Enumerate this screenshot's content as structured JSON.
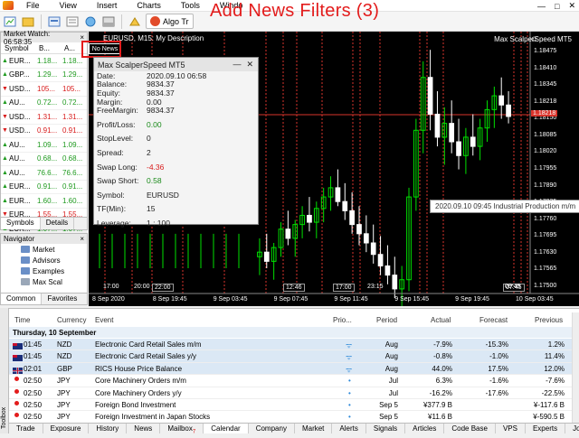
{
  "overlay_title": "Add News Filters (3)",
  "menu": [
    "File",
    "View",
    "Insert",
    "Charts",
    "Tools",
    "Windo"
  ],
  "window_controls": [
    "—",
    "□",
    "✕"
  ],
  "toolbar": {
    "algo_label": "Algo Tr"
  },
  "market_watch": {
    "title": "Market Watch: 06:58:35",
    "close": "×",
    "headers": [
      "Symbol",
      "B...",
      "A..."
    ],
    "rows": [
      {
        "dir": "up",
        "symbol": "EUR...",
        "bid": "1.18...",
        "ask": "1.18..."
      },
      {
        "dir": "up",
        "symbol": "GBP...",
        "bid": "1.29...",
        "ask": "1.29..."
      },
      {
        "dir": "down",
        "symbol": "USD...",
        "bid": "105...",
        "ask": "105..."
      },
      {
        "dir": "up",
        "symbol": "AU...",
        "bid": "0.72...",
        "ask": "0.72..."
      },
      {
        "dir": "down",
        "symbol": "USD...",
        "bid": "1.31...",
        "ask": "1.31..."
      },
      {
        "dir": "down",
        "symbol": "USD...",
        "bid": "0.91...",
        "ask": "0.91..."
      },
      {
        "dir": "up",
        "symbol": "AU...",
        "bid": "1.09...",
        "ask": "1.09..."
      },
      {
        "dir": "up",
        "symbol": "AU...",
        "bid": "0.68...",
        "ask": "0.68..."
      },
      {
        "dir": "up",
        "symbol": "AU...",
        "bid": "76.6...",
        "ask": "76.6..."
      },
      {
        "dir": "up",
        "symbol": "EUR...",
        "bid": "0.91...",
        "ask": "0.91..."
      },
      {
        "dir": "up",
        "symbol": "EUR...",
        "bid": "1.60...",
        "ask": "1.60..."
      },
      {
        "dir": "down",
        "symbol": "EUR...",
        "bid": "1.55...",
        "ask": "1.55..."
      },
      {
        "dir": "up",
        "symbol": "EUR...",
        "bid": "1.07...",
        "ask": "1.07..."
      }
    ],
    "tabs": [
      "Symbols",
      "Details"
    ]
  },
  "navigator": {
    "title": "Navigator",
    "items": [
      "Market",
      "Advisors",
      "Examples",
      "Max Scal"
    ],
    "tabs": [
      "Common",
      "Favorites"
    ]
  },
  "chart": {
    "symbol_title": "EURUSD, M15:  My Description",
    "ea_name": "Max ScalperSpeed MT5",
    "no_news": "No News",
    "tooltip": "2020.09.10 09:45 Industrial Production m/m",
    "price_labels": [
      "1.18475",
      "1.18410",
      "1.18345",
      "1.18218",
      "1.18150",
      "1.18085",
      "1.18020",
      "1.17955",
      "1.17890",
      "1.17825",
      "1.17760",
      "1.17695",
      "1.17630",
      "1.17565",
      "1.17500"
    ],
    "current_price": "1.18218",
    "time_labels": [
      "8 Sep 2020",
      "8 Sep 19:45",
      "9 Sep 03:45",
      "9 Sep 07:45",
      "9 Sep 11:45",
      "9 Sep 15:45",
      "9 Sep 19:45",
      "10 Sep 03:45"
    ],
    "event_times": [
      "17:00",
      "20:00",
      "22:00",
      "12:46",
      "17:00",
      "23:15",
      "05:05",
      "07:45",
      "09:45"
    ],
    "candles": [
      {
        "o": 1.176,
        "h": 1.1768,
        "l": 1.1752,
        "c": 1.1762
      },
      {
        "o": 1.1762,
        "h": 1.177,
        "l": 1.1755,
        "c": 1.1758
      },
      {
        "o": 1.1758,
        "h": 1.1766,
        "l": 1.175,
        "c": 1.1764
      },
      {
        "o": 1.1764,
        "h": 1.1775,
        "l": 1.176,
        "c": 1.1772
      },
      {
        "o": 1.1772,
        "h": 1.178,
        "l": 1.1765,
        "c": 1.1768
      },
      {
        "o": 1.1768,
        "h": 1.1776,
        "l": 1.176,
        "c": 1.1774
      },
      {
        "o": 1.1774,
        "h": 1.1782,
        "l": 1.1768,
        "c": 1.1778
      },
      {
        "o": 1.1778,
        "h": 1.1786,
        "l": 1.1771,
        "c": 1.1775
      },
      {
        "o": 1.1775,
        "h": 1.1784,
        "l": 1.1768,
        "c": 1.1781
      },
      {
        "o": 1.1781,
        "h": 1.179,
        "l": 1.1775,
        "c": 1.1786
      },
      {
        "o": 1.1786,
        "h": 1.1795,
        "l": 1.178,
        "c": 1.179
      },
      {
        "o": 1.179,
        "h": 1.1798,
        "l": 1.1782,
        "c": 1.1784
      },
      {
        "o": 1.1784,
        "h": 1.1792,
        "l": 1.1776,
        "c": 1.178
      },
      {
        "o": 1.178,
        "h": 1.1788,
        "l": 1.177,
        "c": 1.1774
      },
      {
        "o": 1.1774,
        "h": 1.1782,
        "l": 1.1765,
        "c": 1.177
      },
      {
        "o": 1.177,
        "h": 1.1778,
        "l": 1.1762,
        "c": 1.1766
      },
      {
        "o": 1.1766,
        "h": 1.1774,
        "l": 1.1757,
        "c": 1.1761
      },
      {
        "o": 1.1761,
        "h": 1.1769,
        "l": 1.1752,
        "c": 1.1756
      },
      {
        "o": 1.1756,
        "h": 1.1765,
        "l": 1.1748,
        "c": 1.1752
      },
      {
        "o": 1.1752,
        "h": 1.176,
        "l": 1.1742,
        "c": 1.1746
      },
      {
        "o": 1.1746,
        "h": 1.1756,
        "l": 1.1738,
        "c": 1.175
      },
      {
        "o": 1.175,
        "h": 1.179,
        "l": 1.1745,
        "c": 1.1786
      },
      {
        "o": 1.1786,
        "h": 1.182,
        "l": 1.178,
        "c": 1.1815
      },
      {
        "o": 1.1815,
        "h": 1.1845,
        "l": 1.1805,
        "c": 1.1838
      },
      {
        "o": 1.1838,
        "h": 1.185,
        "l": 1.1815,
        "c": 1.1822
      },
      {
        "o": 1.1822,
        "h": 1.1832,
        "l": 1.1808,
        "c": 1.1812
      },
      {
        "o": 1.1812,
        "h": 1.1825,
        "l": 1.18,
        "c": 1.1818
      },
      {
        "o": 1.1818,
        "h": 1.1828,
        "l": 1.1805,
        "c": 1.181
      },
      {
        "o": 1.181,
        "h": 1.182,
        "l": 1.1798,
        "c": 1.1804
      },
      {
        "o": 1.1804,
        "h": 1.1816,
        "l": 1.1796,
        "c": 1.1812
      },
      {
        "o": 1.1812,
        "h": 1.1822,
        "l": 1.1804,
        "c": 1.1808
      },
      {
        "o": 1.1808,
        "h": 1.182,
        "l": 1.1802,
        "c": 1.1816
      },
      {
        "o": 1.1816,
        "h": 1.1828,
        "l": 1.181,
        "c": 1.1824
      },
      {
        "o": 1.1824,
        "h": 1.1834,
        "l": 1.1816,
        "c": 1.183
      },
      {
        "o": 1.183,
        "h": 1.1838,
        "l": 1.182,
        "c": 1.1826
      },
      {
        "o": 1.1826,
        "h": 1.1832,
        "l": 1.1818,
        "c": 1.1821
      }
    ]
  },
  "panel": {
    "title": "Max ScalperSpeed MT5",
    "rows": [
      {
        "k": "Date:",
        "v": "2020.09.10 06:58",
        "c": ""
      },
      {
        "k": "Balance:",
        "v": "9834.37",
        "c": ""
      },
      {
        "k": "Equity:",
        "v": "9834.37",
        "c": ""
      },
      {
        "k": "Margin:",
        "v": "0.00",
        "c": ""
      },
      {
        "k": "FreeMargin:",
        "v": "9834.37",
        "c": ""
      },
      {
        "k": "",
        "v": "",
        "c": "gap"
      },
      {
        "k": "Profit/Loss:",
        "v": "0.00",
        "c": "pos"
      },
      {
        "k": "",
        "v": "",
        "c": "gap"
      },
      {
        "k": "StopLevel:",
        "v": "0",
        "c": ""
      },
      {
        "k": "",
        "v": "",
        "c": "gap"
      },
      {
        "k": "Spread:",
        "v": "2",
        "c": ""
      },
      {
        "k": "",
        "v": "",
        "c": "gap"
      },
      {
        "k": "Swap Long:",
        "v": "-4.36",
        "c": "neg"
      },
      {
        "k": "",
        "v": "",
        "c": "gap"
      },
      {
        "k": "Swap Short:",
        "v": "0.58",
        "c": "pos"
      },
      {
        "k": "",
        "v": "",
        "c": "gap"
      },
      {
        "k": "Symbol:",
        "v": "EURUSD",
        "c": ""
      },
      {
        "k": "",
        "v": "",
        "c": "gap"
      },
      {
        "k": "TF(Min):",
        "v": "15",
        "c": ""
      },
      {
        "k": "",
        "v": "",
        "c": "gap"
      },
      {
        "k": "Leverage:",
        "v": "1 : 100",
        "c": ""
      }
    ]
  },
  "calendar": {
    "headers": {
      "time": "Time",
      "currency": "Currency",
      "event": "Event",
      "prio": "Prio...",
      "period": "Period",
      "actual": "Actual",
      "forecast": "Forecast",
      "previous": "Previous"
    },
    "day": "Thursday, 10 September",
    "rows": [
      {
        "flag": "nz",
        "time": "01:45",
        "cur": "NZD",
        "event": "Electronic Card Retail Sales m/m",
        "imp": "high",
        "period": "Aug",
        "actual": "-7.9%",
        "forecast": "-15.3%",
        "previous": "1.2%",
        "alt": true
      },
      {
        "flag": "nz",
        "time": "01:45",
        "cur": "NZD",
        "event": "Electronic Card Retail Sales y/y",
        "imp": "high",
        "period": "Aug",
        "actual": "-0.8%",
        "forecast": "-1.0%",
        "previous": "11.4%",
        "alt": true
      },
      {
        "flag": "gb",
        "time": "02:01",
        "cur": "GBP",
        "event": "RICS House Price Balance",
        "imp": "high",
        "period": "Aug",
        "actual": "44.0%",
        "forecast": "17.5%",
        "previous": "12.0%",
        "alt": true
      },
      {
        "flag": "jp",
        "time": "02:50",
        "cur": "JPY",
        "event": "Core Machinery Orders m/m",
        "imp": "low",
        "period": "Jul",
        "actual": "6.3%",
        "forecast": "-1.6%",
        "previous": "-7.6%",
        "alt": false
      },
      {
        "flag": "jp",
        "time": "02:50",
        "cur": "JPY",
        "event": "Core Machinery Orders y/y",
        "imp": "low",
        "period": "Jul",
        "actual": "-16.2%",
        "forecast": "-17.6%",
        "previous": "-22.5%",
        "alt": false
      },
      {
        "flag": "jp",
        "time": "02:50",
        "cur": "JPY",
        "event": "Foreign Bond Investment",
        "imp": "low",
        "period": "Sep 5",
        "actual": "¥377.9 B",
        "forecast": "",
        "previous": "¥-117.6 B",
        "alt": false
      },
      {
        "flag": "jp",
        "time": "02:50",
        "cur": "JPY",
        "event": "Foreign Investment in Japan Stocks",
        "imp": "low",
        "period": "Sep 5",
        "actual": "¥11.6 B",
        "forecast": "",
        "previous": "¥-590.5 B",
        "alt": false
      }
    ]
  },
  "side_label": "Toolbox",
  "bottom_tabs": [
    "Trade",
    "Exposure",
    "History",
    "News",
    "Mailbox",
    "Calendar",
    "Company",
    "Market",
    "Alerts",
    "Signals",
    "Articles",
    "Code Base",
    "VPS",
    "Experts",
    "Journal"
  ],
  "mailbox_badge": "7",
  "colors": {
    "bull": "#00e000",
    "bear": "#ffffff",
    "event_line": "#d9342b",
    "price_line": "#d9342b",
    "accent_red": "#e31c1c"
  }
}
